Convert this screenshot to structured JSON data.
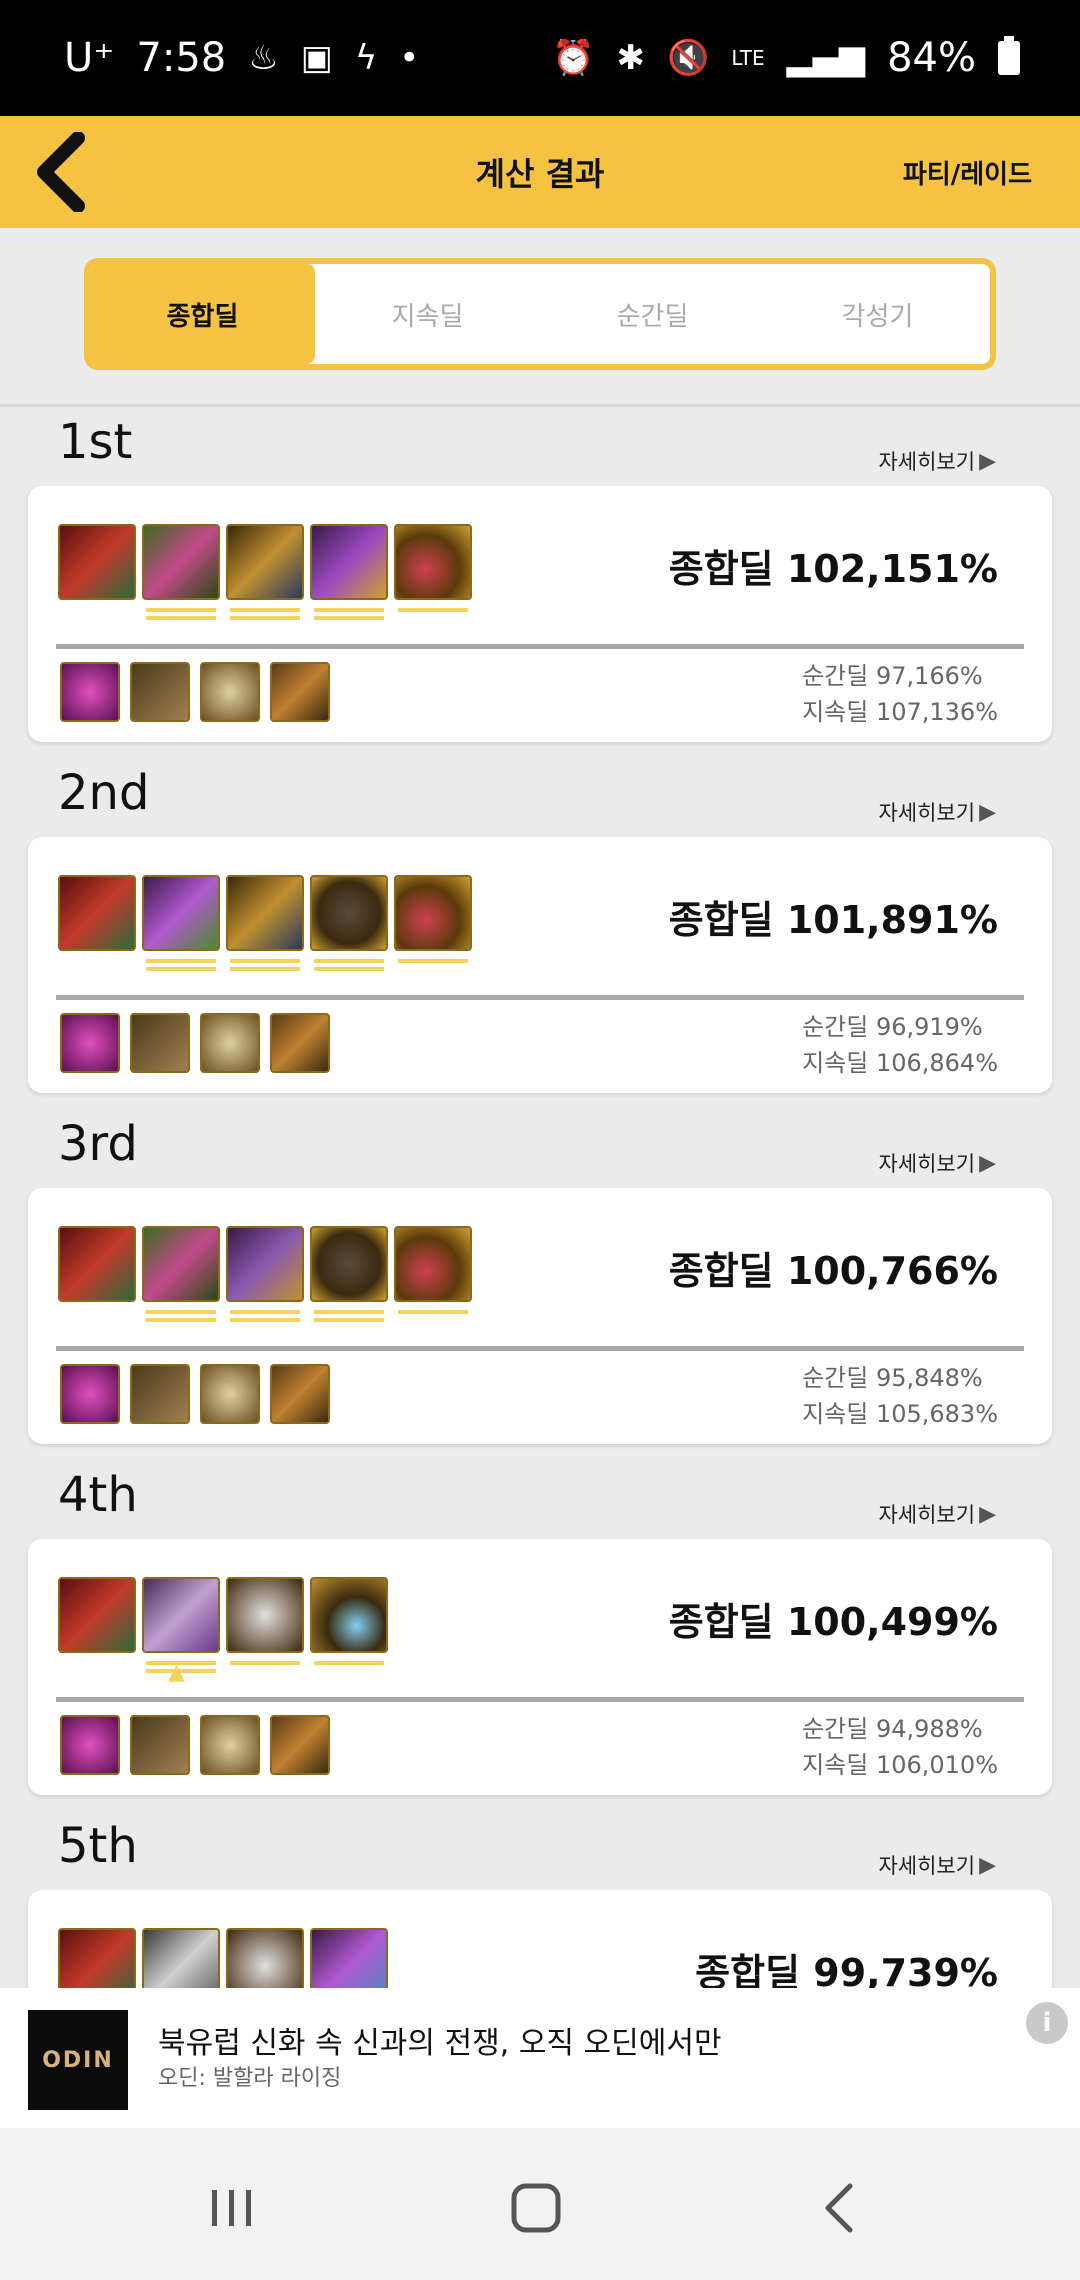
{
  "status": {
    "carrier": "U⁺",
    "time": "7:58",
    "network": "LTE",
    "battery": "84%"
  },
  "appbar": {
    "title": "계산 결과",
    "action": "파티/레이드"
  },
  "tabs": [
    "종합딜",
    "지속딜",
    "순간딜",
    "각성기"
  ],
  "detail_label": "자세히보기",
  "ranks": [
    {
      "label": "1st",
      "total": "종합딜 102,151%",
      "burst": "순간딜 97,166%",
      "sustain": "지속딜 107,136%"
    },
    {
      "label": "2nd",
      "total": "종합딜 101,891%",
      "burst": "순간딜 96,919%",
      "sustain": "지속딜 106,864%"
    },
    {
      "label": "3rd",
      "total": "종합딜 100,766%",
      "burst": "순간딜 95,848%",
      "sustain": "지속딜 105,683%"
    },
    {
      "label": "4th",
      "total": "종합딜 100,499%",
      "burst": "순간딜 94,988%",
      "sustain": "지속딜 106,010%"
    },
    {
      "label": "5th",
      "total": "종합딜 99,739%",
      "burst": "",
      "sustain": ""
    }
  ],
  "ad": {
    "logo": "ODIN",
    "title": "북유럽 신화 속 신과의 전쟁, 오직 오딘에서만",
    "subtitle": "오딘: 발할라 라이징"
  },
  "colors": {
    "accent": "#f5c242",
    "underline": "#f3d35c",
    "background": "#ebebeb"
  }
}
